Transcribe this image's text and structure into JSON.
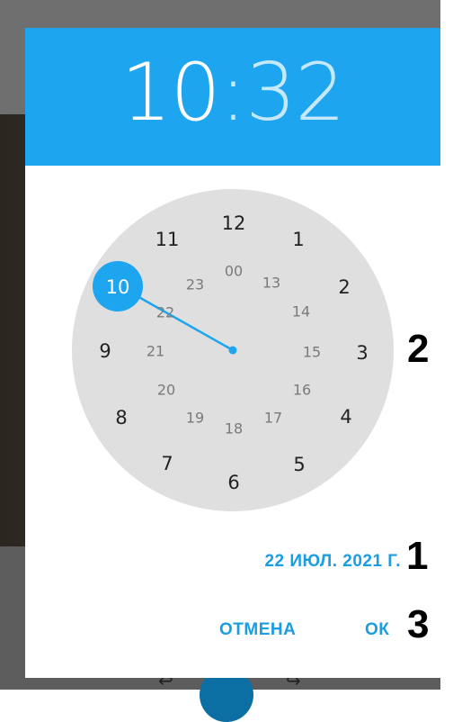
{
  "header": {
    "hours": "10",
    "separator": ":",
    "minutes": "32"
  },
  "clock": {
    "outer": [
      "12",
      "1",
      "2",
      "3",
      "4",
      "5",
      "6",
      "7",
      "8",
      "9",
      "10",
      "11"
    ],
    "inner": [
      "00",
      "13",
      "14",
      "15",
      "16",
      "17",
      "18",
      "19",
      "20",
      "21",
      "22",
      "23"
    ],
    "selected_hour": "10"
  },
  "date_label": "22 ИЮЛ. 2021 Г.",
  "buttons": {
    "cancel": "ОТМЕНА",
    "ok": "ОК"
  },
  "annotations": {
    "a1": "1",
    "a2": "2",
    "a3": "3"
  },
  "colors": {
    "accent": "#1ea5ef",
    "clock_face": "#dfdfdf"
  }
}
